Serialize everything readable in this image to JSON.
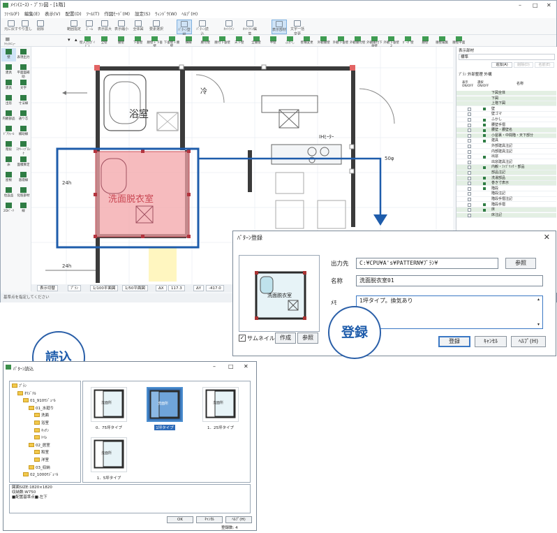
{
  "main_window": {
    "title": "ﾒｲﾝ(ｴｰｽ) - ﾌﾟﾗﾝ図 - [1階]",
    "menu": [
      "ﾌｧｲﾙ(F)",
      "編集(E)",
      "表示(V)",
      "配置(D)",
      "ﾂｰﾙ(T)",
      "作図ﾓｰﾄﾞ(M)",
      "設定(S)",
      "ｳｨﾝﾄﾞｳ(W)",
      "ﾍﾙﾌﾟ(H)"
    ],
    "toolbar": [
      "元に戻す",
      "やり直し",
      "削除",
      "範囲指定",
      "ｽﾞｰﾑ",
      "表示拡大",
      "表示縮小",
      "全体図",
      "要素選択",
      "ﾊﾟﾀｰﾝ登録",
      "ﾊﾟﾀｰﾝ読込",
      "ｶｯﾄﾗｲﾝ",
      "ｶｯﾄﾗｲﾝ編集",
      "表示部材",
      "文字一括変更"
    ],
    "floor": "1階",
    "toolbar2": [
      "壁入力(ｶﾞｲﾄﾞ)",
      "全壁",
      "腰壁",
      "下垂壁",
      "腰壁＋下垂壁",
      "下垂壁＋腰壁",
      "横線",
      "腰付壁",
      "腰付下垂壁",
      "天下壁",
      "全腰壁",
      "半壁",
      "ふかし",
      "壁種変更",
      "外観腰壁",
      "外観下垂壁",
      "外観腰付壁",
      "外観腰付下垂壁",
      "外観下垂壁2",
      "ﾎﾞｰﾀﾞ壁",
      "腰壁",
      "腰壁編集",
      "腰壁平面"
    ],
    "left_palette": [
      "壁",
      "表現出力",
      "建具",
      "平面図補助",
      "建具",
      "文字",
      "出窓",
      "寸法線",
      "内観部品",
      "通り芯",
      "ﾄﾞｱｳｫｰﾙ",
      "補助線",
      "階段",
      "ｽｸﾘｰﾝﾌﾞﾛｯｸ",
      "床",
      "面積算定",
      "屋根",
      "基礎線",
      "住設品",
      "化粧部材",
      "2Dﾊﾟｰﾂ",
      "線"
    ],
    "canvas": {
      "rooms": [
        "浴室",
        "洗面脱衣室",
        "冷",
        "IHﾋｰﾀｰ",
        "50φ",
        "24h",
        "24h"
      ]
    },
    "statusbar": [
      "表示切替",
      "ﾌﾟﾗﾝ",
      "1/100平面図",
      "1/50平面図",
      "ΔX",
      "117.3",
      "ΔY",
      "-417.0"
    ],
    "bottom_text": "基準点を指定してください",
    "right_panel": {
      "title": "表示部材",
      "select": "標準",
      "buttons": [
        "追加(A)",
        "削除(D)",
        "名前(E)"
      ],
      "tabs": [
        "ﾌﾟﾗﾝ",
        "外部整理",
        "外構"
      ],
      "headers": [
        "表示 ON/OFF",
        "選択 ON/OFF",
        "名称"
      ],
      "rows": [
        {
          "name": "下図全体",
          "green": true,
          "cb": false,
          "ic": false
        },
        {
          "name": "下図",
          "green": true,
          "cb": false,
          "ic": false
        },
        {
          "name": "上階下図",
          "green": true,
          "cb": false,
          "ic": false
        },
        {
          "name": "壁",
          "green": false,
          "cb": true,
          "ic": true
        },
        {
          "name": "壁ゴマ",
          "green": false,
          "cb": true,
          "ic": false
        },
        {
          "name": "ふかし",
          "green": false,
          "cb": true,
          "ic": true
        },
        {
          "name": "腰壁手摺",
          "green": false,
          "cb": true,
          "ic": true
        },
        {
          "name": "腰壁・腰壁名",
          "green": true,
          "cb": true,
          "ic": true
        },
        {
          "name": "小屋裏・中間階・天下部分",
          "green": true,
          "cb": true,
          "ic": true
        },
        {
          "name": "建具",
          "green": false,
          "cb": true,
          "ic": true
        },
        {
          "name": "外部建具注記",
          "green": false,
          "cb": true,
          "ic": false
        },
        {
          "name": "内部建具注記",
          "green": false,
          "cb": true,
          "ic": false
        },
        {
          "name": "出窓",
          "green": false,
          "cb": true,
          "ic": true
        },
        {
          "name": "出窓建具注記",
          "green": false,
          "cb": true,
          "ic": false
        },
        {
          "name": "内観・ﾌｧﾌﾞﾘｯｸ・部品",
          "green": true,
          "cb": true,
          "ic": true
        },
        {
          "name": "部品注記",
          "green": true,
          "cb": true,
          "ic": false
        },
        {
          "name": "洗濯部品",
          "green": true,
          "cb": true,
          "ic": true
        },
        {
          "name": "巻き寸表示",
          "green": true,
          "cb": true,
          "ic": true
        },
        {
          "name": "階段",
          "green": false,
          "cb": true,
          "ic": true
        },
        {
          "name": "階段注記",
          "green": false,
          "cb": true,
          "ic": false
        },
        {
          "name": "階段手摺注記",
          "green": false,
          "cb": true,
          "ic": false
        },
        {
          "name": "階段手摺",
          "green": false,
          "cb": true,
          "ic": true
        },
        {
          "name": "床",
          "green": true,
          "cb": true,
          "ic": true
        },
        {
          "name": "床注記",
          "green": true,
          "cb": true,
          "ic": false
        }
      ]
    }
  },
  "register_dialog": {
    "title": "ﾊﾟﾀｰﾝ登録",
    "preview_room": "洗面脱衣室",
    "thumbnail_label": "サムネイル",
    "make_button": "作成",
    "browse_button": "参照",
    "output_label": "出力先",
    "output_value": "C:¥CPU¥A's¥PATTERN¥ﾌﾟﾗﾝ¥",
    "output_browse": "参照",
    "name_label": "名称",
    "name_value": "洗面脱衣室01",
    "memo_label": "ﾒﾓ",
    "memo_value": "1坪タイプ。換気あり",
    "ok_button": "登録",
    "cancel_button": "ｷｬﾝｾﾙ",
    "help_button": "ﾍﾙﾌﾟ(H)"
  },
  "callout_register": "登録",
  "callout_load": "読込",
  "load_dialog": {
    "title": "ﾊﾟﾀｰﾝ読込",
    "tree": [
      {
        "label": "ﾌﾟﾗﾝ",
        "level": 0
      },
      {
        "label": "ｵﾘｼﾞﾅﾙ",
        "level": 1
      },
      {
        "label": "01_910ﾓｼﾞｭｰﾙ",
        "level": 2
      },
      {
        "label": "01_水廻り",
        "level": 3
      },
      {
        "label": "洗面",
        "level": 4
      },
      {
        "label": "浴室",
        "level": 4
      },
      {
        "label": "ｷｯﾁﾝ",
        "level": 4
      },
      {
        "label": "ﾄｲﾚ",
        "level": 4
      },
      {
        "label": "02_居室",
        "level": 3
      },
      {
        "label": "和室",
        "level": 4
      },
      {
        "label": "洋室",
        "level": 4
      },
      {
        "label": "03_収納",
        "level": 3
      },
      {
        "label": "02_1000ﾓｼﾞｭｰﾙ",
        "level": 2
      }
    ],
    "thumbnails": [
      {
        "label": "0．75坪タイプ",
        "room": "洗面所",
        "selected": false
      },
      {
        "label": "1坪タイプ",
        "room": "洗面所",
        "selected": true
      },
      {
        "label": "1．25坪タイプ",
        "room": "洗面所",
        "selected": false
      },
      {
        "label": "1．5坪タイプ",
        "room": "洗面所",
        "selected": false
      }
    ],
    "info_lines": [
      "図面SIZE:1820×1820",
      "収納数:W750",
      "■配置基準点■:左下"
    ],
    "ok_button": "OK",
    "cancel_button": "ｷｬﾝｾﾙ",
    "help_button": "ﾍﾙﾌﾟ(H)",
    "count_text": "登録数: 4"
  }
}
